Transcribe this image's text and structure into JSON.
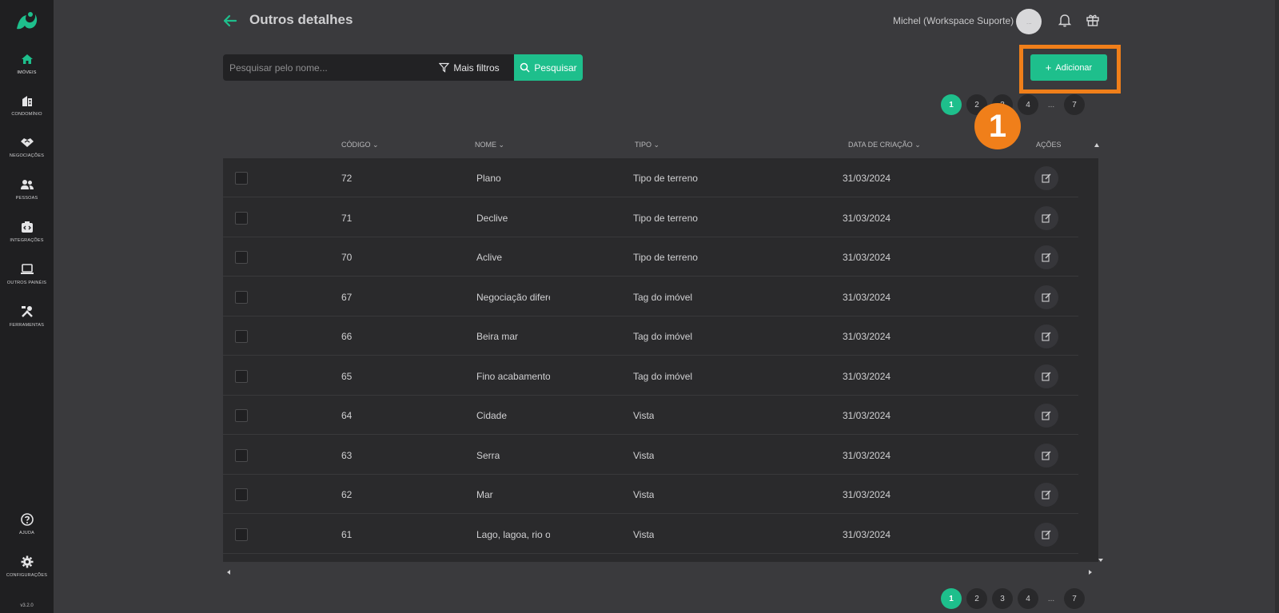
{
  "sidebar": {
    "items": [
      {
        "label": "Imóveis",
        "icon": "home-icon"
      },
      {
        "label": "Condomínio",
        "icon": "building-icon"
      },
      {
        "label": "Negociações",
        "icon": "handshake-icon"
      },
      {
        "label": "Pessoas",
        "icon": "people-icon"
      },
      {
        "label": "Integrações",
        "icon": "integration-icon"
      },
      {
        "label": "Outros painéis",
        "icon": "laptop-icon"
      },
      {
        "label": "Ferramentas",
        "icon": "tools-icon"
      }
    ],
    "bottom_items": [
      {
        "label": "Ajuda",
        "icon": "help-icon"
      },
      {
        "label": "Configurações",
        "icon": "settings-icon"
      }
    ],
    "version": "v3.2.0"
  },
  "header": {
    "title": "Outros detalhes",
    "user_name": "Michel (Workspace Suporte)",
    "avatar_text": "..."
  },
  "search": {
    "placeholder": "Pesquisar pelo nome...",
    "filters_label": "Mais filtros",
    "search_label": "Pesquisar"
  },
  "add_button": {
    "label": "Adicionar"
  },
  "step_badge": "1",
  "pagination": {
    "pages": [
      "1",
      "2",
      "3",
      "4"
    ],
    "ellipsis": "...",
    "last": "7",
    "current": "1"
  },
  "table": {
    "columns": [
      "Código",
      "Nome",
      "Tipo",
      "Data de criação",
      "Ações"
    ],
    "rows": [
      {
        "code": "72",
        "name": "Plano",
        "type": "Tipo de terreno",
        "date": "31/03/2024"
      },
      {
        "code": "71",
        "name": "Declive",
        "type": "Tipo de terreno",
        "date": "31/03/2024"
      },
      {
        "code": "70",
        "name": "Aclive",
        "type": "Tipo de terreno",
        "date": "31/03/2024"
      },
      {
        "code": "67",
        "name": "Negociação difere",
        "type": "Tag do imóvel",
        "date": "31/03/2024"
      },
      {
        "code": "66",
        "name": "Beira mar",
        "type": "Tag do imóvel",
        "date": "31/03/2024"
      },
      {
        "code": "65",
        "name": "Fino acabamento",
        "type": "Tag do imóvel",
        "date": "31/03/2024"
      },
      {
        "code": "64",
        "name": "Cidade",
        "type": "Vista",
        "date": "31/03/2024"
      },
      {
        "code": "63",
        "name": "Serra",
        "type": "Vista",
        "date": "31/03/2024"
      },
      {
        "code": "62",
        "name": "Mar",
        "type": "Vista",
        "date": "31/03/2024"
      },
      {
        "code": "61",
        "name": "Lago, lagoa, rio ou",
        "type": "Vista",
        "date": "31/03/2024"
      }
    ]
  },
  "colors": {
    "accent": "#1ebf8c",
    "highlight": "#f07f1a",
    "background": "#3a3a3d",
    "sidebar": "#1f1f21"
  }
}
